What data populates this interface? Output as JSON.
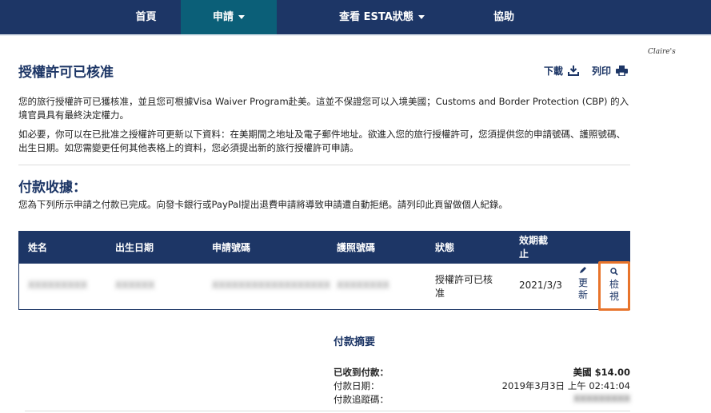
{
  "nav": {
    "home": "首頁",
    "apply": "申請",
    "status": "查看 ESTA狀態",
    "help": "協助"
  },
  "page": {
    "title": "授權許可已核准",
    "download": "下載",
    "print": "列印",
    "watermark": "Claire's",
    "paragraph1": "您的旅行授權許可已獲核准，並且您可根據Visa Waiver Program赴美。這並不保證您可以入境美國；Customs and Border Protection (CBP) 的入境官員具有最終決定權力。",
    "paragraph2": "如必要，你可以在已批准之授權許可更新以下資料：在美期間之地址及電子郵件地址。欲進入您的旅行授權許可，您須提供您的申請號碼、護照號碼、出生日期。如您需變更任何其他表格上的資料，您必須提出新的旅行授權許可申請。"
  },
  "payment": {
    "title": "付款收據：",
    "description": "您為下列所示申請之付款已完成。向發卡銀行或PayPal提出退費申請將導致申請遭自動拒絕。請列印此頁留做個人紀錄。"
  },
  "table": {
    "headers": {
      "name": "姓名",
      "dob": "出生日期",
      "application_number": "申請號碼",
      "passport_number": "護照號碼",
      "status": "狀態",
      "expiry": "效期截止"
    },
    "row": {
      "name": "XXXXXXXXX",
      "dob": "XXXXXX",
      "application_number": "XXXXXXXXXXXXXXXXXX",
      "passport_number": "XXXXXXXX",
      "status": "授權許可已核准",
      "expiry": "2021/3/3",
      "update": "更新",
      "view": "檢視"
    }
  },
  "summary": {
    "title": "付款摘要",
    "received_label": "已收到付款：",
    "received_value": "美國 $14.00",
    "date_label": "付款日期：",
    "date_value": "2019年3月3日 上午 02:41:04",
    "tracking_label": "付款追蹤碼：",
    "tracking_value": "XXXXXXXXX"
  },
  "colors": {
    "nav": "#1d3666",
    "nav_active": "#0b5f78",
    "highlight": "#e8742b"
  }
}
